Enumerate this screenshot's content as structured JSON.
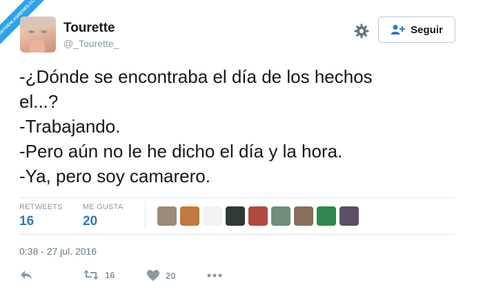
{
  "watermark": {
    "text": "VISTOENLASREDES.COM",
    "color": "#2aa3e8"
  },
  "user": {
    "name": "Tourette",
    "handle": "@_Tourette_"
  },
  "follow_button": {
    "label": "Seguir",
    "icon": "add-user-icon"
  },
  "tweet": {
    "lines": [
      "-¿Dónde se encontraba el día de los hechos",
      "el...?",
      "-Trabajando.",
      "-Pero aún no le he dicho el día y la hora.",
      "-Ya, pero soy camarero."
    ]
  },
  "stats": {
    "retweets_label": "RETWEETS",
    "retweets_value": "16",
    "likes_label": "ME GUSTA",
    "likes_value": "20"
  },
  "likers": [
    {
      "color": "#9c8b7a"
    },
    {
      "color": "#c2783e"
    },
    {
      "color": "#f2f2f2"
    },
    {
      "color": "#2f3b35"
    },
    {
      "color": "#b04a3e"
    },
    {
      "color": "#6f8e7c"
    },
    {
      "color": "#8a6f5c"
    },
    {
      "color": "#2e8a4c"
    },
    {
      "color": "#5a4f66"
    }
  ],
  "timestamp": "0:38 - 27 jul. 2016",
  "actions": {
    "reply_icon": "reply-icon",
    "retweet_count": "16",
    "like_count": "20",
    "more_icon": "more-icon"
  },
  "colors": {
    "accent": "#2b7bb9",
    "muted": "#8899a6",
    "divider": "#e1e8ed"
  }
}
